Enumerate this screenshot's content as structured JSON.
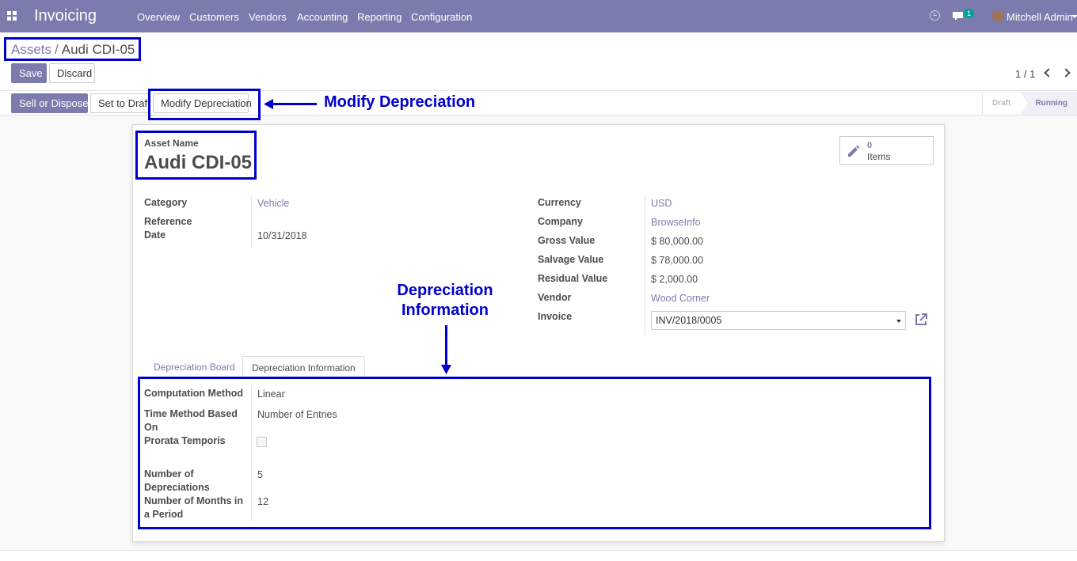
{
  "navbar": {
    "app_title": "Invoicing",
    "menu": [
      "Overview",
      "Customers",
      "Vendors",
      "Accounting",
      "Reporting",
      "Configuration"
    ],
    "chat_badge": "1",
    "user_name": "Mitchell Admin",
    "color": "#7c7bad"
  },
  "breadcrumb": {
    "parent": "Assets",
    "separator": "/",
    "current": "Audi CDI-05"
  },
  "buttons": {
    "save": "Save",
    "discard": "Discard",
    "sell_dispose": "Sell or Dispose",
    "set_draft": "Set to Draft",
    "modify_depreciation": "Modify Depreciation"
  },
  "pager": {
    "text": "1 / 1"
  },
  "status": {
    "draft": "Draft",
    "running": "Running"
  },
  "smart_button": {
    "count": "0",
    "label": "Items",
    "icon": "pencil-icon"
  },
  "asset": {
    "name_label": "Asset Name",
    "name": "Audi CDI-05"
  },
  "left_fields": {
    "category_label": "Category",
    "category": "Vehicle",
    "ref_date_label_1": "Reference",
    "ref_date_label_2": "Date",
    "ref_date": "10/31/2018"
  },
  "right_fields": {
    "currency_label": "Currency",
    "currency": "USD",
    "company_label": "Company",
    "company": "BrowseInfo",
    "gross_label": "Gross Value",
    "gross": "$ 80,000.00",
    "salvage_label": "Salvage Value",
    "salvage": "$ 78,000.00",
    "residual_label": "Residual Value",
    "residual": "$ 2,000.00",
    "vendor_label": "Vendor",
    "vendor": "Wood Corner",
    "invoice_label": "Invoice",
    "invoice": "INV/2018/0005"
  },
  "tabs": {
    "board": "Depreciation Board",
    "info": "Depreciation Information"
  },
  "depreciation": {
    "method_label": "Computation Method",
    "method": "Linear",
    "time_label_1": "Time Method Based",
    "time_label_2": "On",
    "time": "Number of Entries",
    "prorata_label": "Prorata Temporis",
    "prorata_checked": false,
    "num_dep_label_1": "Number of",
    "num_dep_label_2": "Depreciations",
    "num_dep": "5",
    "months_label_1": "Number of Months in",
    "months_label_2": "a Period",
    "months": "12"
  },
  "annotations": {
    "modify": "Modify Depreciation",
    "dep_info_1": "Depreciation",
    "dep_info_2": "Information",
    "color": "#0000cd"
  }
}
